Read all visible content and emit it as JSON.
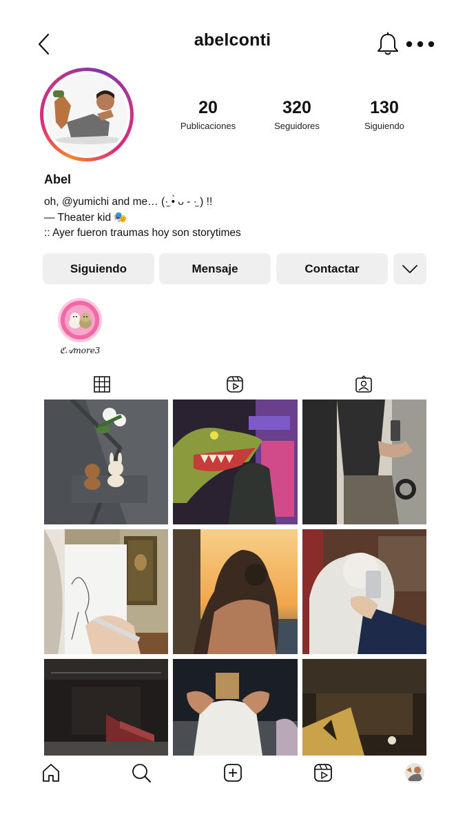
{
  "header": {
    "username": "abelconti",
    "back_icon": "chevron-left-icon",
    "notifications_icon": "bell-icon",
    "more_icon": "more-horizontal-icon"
  },
  "profile": {
    "display_name": "Abel",
    "bio": [
      "oh, @yumichi and me… (·̫ •̀ ᴗ - ·̫ ) !!",
      "— Theater kid 🎭",
      ":: Ayer fueron traumas hoy son storytimes"
    ],
    "stats": [
      {
        "value": "20",
        "label": "Publicaciones"
      },
      {
        "value": "320",
        "label": "Seguidores"
      },
      {
        "value": "130",
        "label": "Siguiendo"
      }
    ]
  },
  "actions": {
    "following": "Siguiendo",
    "message": "Mensaje",
    "contact": "Contactar",
    "dropdown_icon": "chevron-down-icon"
  },
  "highlights": [
    {
      "label": "ℭ𝒜more3"
    }
  ],
  "tabs": [
    "grid-icon",
    "reels-icon",
    "tagged-icon"
  ],
  "posts": [
    "suit-lapel-with-toys",
    "dinosaur-costume-store",
    "person-with-phone-camera-rig",
    "sketching-mona-lisa",
    "couple-hug-sunset",
    "statue-holding-phone",
    "empty-theater-stage",
    "man-with-paper-bag-head",
    "theater-hamilton-program"
  ],
  "bottom_nav": [
    "home-icon",
    "search-icon",
    "create-icon",
    "reels-icon",
    "profile-avatar"
  ],
  "colors": {
    "button_bg": "#efefef",
    "story_ring_start": "#f58529",
    "story_ring_end": "#8134af"
  }
}
